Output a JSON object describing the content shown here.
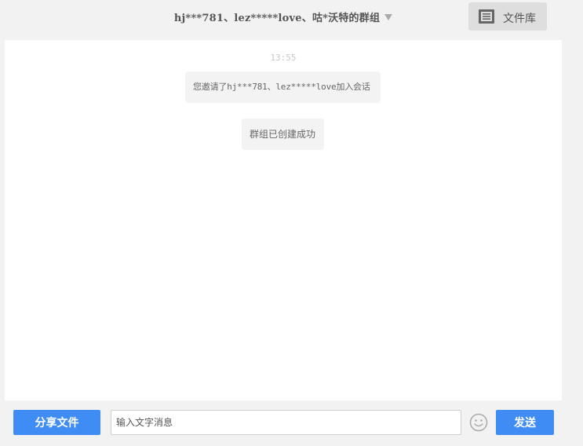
{
  "header": {
    "group_title": "hj***781、lez*****love、咕*沃特的群组",
    "file_library_label": "文件库"
  },
  "chat": {
    "timestamp": "13:55",
    "messages": [
      {
        "text": "您邀请了hj***781、lez*****love加入会话"
      },
      {
        "text": "群组已创建成功"
      }
    ]
  },
  "footer": {
    "share_file_label": "分享文件",
    "input_placeholder": "输入文字消息",
    "input_value": "",
    "send_label": "发送"
  },
  "icons": {
    "caret": "chevron-down-icon",
    "file_library": "document-icon",
    "emoji": "smiley-icon"
  },
  "colors": {
    "accent": "#3f8cf4",
    "background": "#f2f2f2",
    "chat_background": "#ffffff",
    "bubble": "#f3f3f3"
  }
}
